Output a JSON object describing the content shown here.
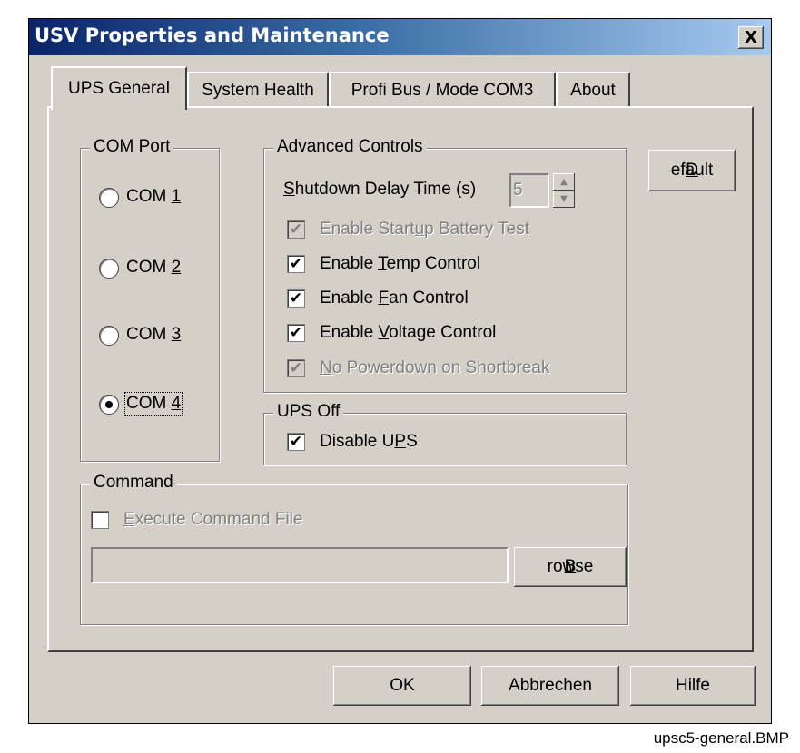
{
  "window": {
    "title": "USV Properties and Maintenance",
    "close_label": "X"
  },
  "tabs": [
    {
      "label": "UPS General",
      "active": true
    },
    {
      "label": "System Health",
      "active": false
    },
    {
      "label": "Profi Bus / Mode COM3",
      "active": false
    },
    {
      "label": "About",
      "active": false
    }
  ],
  "com_port": {
    "legend": "COM Port",
    "options": [
      {
        "prefix": "COM ",
        "mnemonic": "1",
        "selected": false
      },
      {
        "prefix": "COM ",
        "mnemonic": "2",
        "selected": false
      },
      {
        "prefix": "COM ",
        "mnemonic": "3",
        "selected": false
      },
      {
        "prefix": "COM ",
        "mnemonic": "4",
        "selected": true
      }
    ]
  },
  "advanced": {
    "legend": "Advanced Controls",
    "shutdown": {
      "mnemonic": "S",
      "rest": "hutdown Delay Time (s)",
      "value": "5"
    },
    "checks": [
      {
        "before": "Enable Start",
        "mnemonic": "u",
        "after": "p Battery Test",
        "checked": true,
        "enabled": false
      },
      {
        "before": "Enable ",
        "mnemonic": "T",
        "after": "emp Control",
        "checked": true,
        "enabled": true
      },
      {
        "before": "Enable ",
        "mnemonic": "F",
        "after": "an Control",
        "checked": true,
        "enabled": true
      },
      {
        "before": "Enable ",
        "mnemonic": "V",
        "after": "oltage Control",
        "checked": true,
        "enabled": true
      },
      {
        "before": "",
        "mnemonic": "N",
        "after": "o Powerdown on Shortbreak",
        "checked": true,
        "enabled": false
      }
    ]
  },
  "ups_off": {
    "legend": "UPS Off",
    "check": {
      "before": "Disable U",
      "mnemonic": "P",
      "after": "S",
      "checked": true
    }
  },
  "command": {
    "legend": "Command",
    "execute": {
      "before": "",
      "mnemonic": "E",
      "after": "xecute Command File",
      "checked": false
    },
    "path_value": "",
    "browse": {
      "mnemonic": "B",
      "rest": "rowse"
    }
  },
  "buttons": {
    "default": {
      "mnemonic": "D",
      "rest": "efault"
    },
    "ok": "OK",
    "cancel": "Abbrechen",
    "help": "Hilfe"
  },
  "caption": "upsc5-general.BMP",
  "check_glyph": "✔"
}
